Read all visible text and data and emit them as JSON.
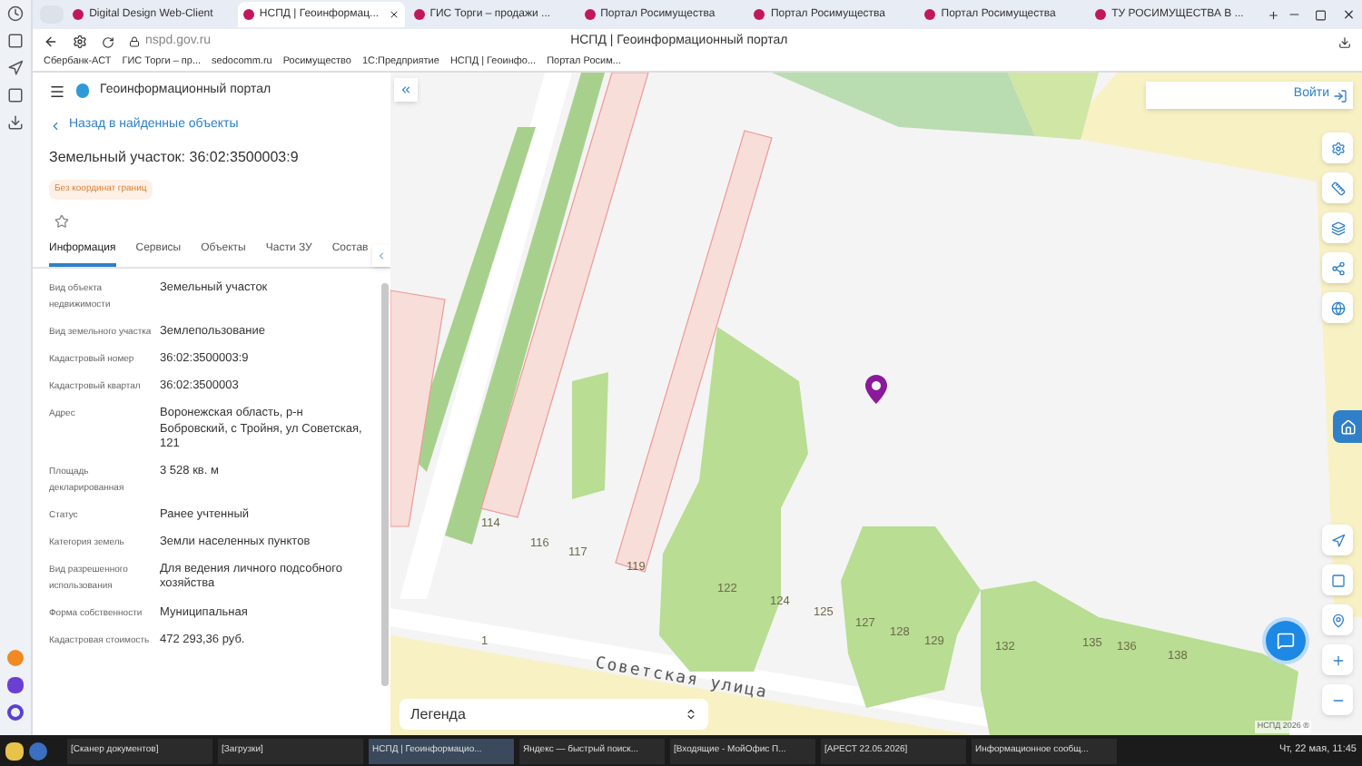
{
  "browser": {
    "tabs": [
      {
        "title": "Digital Design Web-Client",
        "selected": false
      },
      {
        "title": "НСПД | Геоинформац...",
        "selected": true
      },
      {
        "title": "ГИС Торги – продажи ...",
        "selected": false
      },
      {
        "title": "Портал Росимущества",
        "selected": false
      },
      {
        "title": "Портал Росимущества",
        "selected": false
      },
      {
        "title": "Портал Росимущества",
        "selected": false
      },
      {
        "title": "ТУ РОСИМУЩЕСТВА В ...",
        "selected": false
      }
    ],
    "address": "nspd.gov.ru",
    "page_title": "НСПД | Геоинформационный портал",
    "bookmarks": [
      "Сбербанк-АСТ",
      "ГИС Торги – пр...",
      "sedocomm.ru",
      "Росимущество",
      "1С:Предприятие",
      "НСПД | Геоинфо...",
      "Портал Росим..."
    ]
  },
  "panel": {
    "portal_name": "Геоинформационный портал",
    "back_link": "Назад в найденные объекты",
    "title": "Земельный участок: 36:02:3500003:9",
    "badge": "Без координат границ",
    "tabs": [
      {
        "label": "Информация",
        "selected": true
      },
      {
        "label": "Сервисы",
        "selected": false
      },
      {
        "label": "Объекты",
        "selected": false
      },
      {
        "label": "Части ЗУ",
        "selected": false
      },
      {
        "label": "Состав",
        "selected": false
      }
    ],
    "rows": [
      {
        "label": "Вид объекта недвижимости",
        "value": "Земельный участок"
      },
      {
        "label": "Вид земельного участка",
        "value": "Землепользование"
      },
      {
        "label": "Кадастровый номер",
        "value": "36:02:3500003:9"
      },
      {
        "label": "Кадастровый квартал",
        "value": "36:02:3500003"
      },
      {
        "label": "Адрес",
        "value": "Воронежская область, р-н Бобровский, с Тройня, ул Советская, 121"
      },
      {
        "label": "Площадь декларированная",
        "value": "3 528 кв. м"
      },
      {
        "label": "Статус",
        "value": "Ранее учтенный"
      },
      {
        "label": "Категория земель",
        "value": "Земли населенных пунктов"
      },
      {
        "label": "Вид разрешенного использования",
        "value": "Для ведения личного подсобного хозяйства"
      },
      {
        "label": "Форма собственности",
        "value": "Муниципальная"
      },
      {
        "label": "Кадастровая стоимость",
        "value": "472 293,36 руб."
      }
    ]
  },
  "map": {
    "login_button": "Войти",
    "house_numbers": [
      "114",
      "116",
      "117",
      "119",
      "122",
      "124",
      "125",
      "127",
      "128",
      "129",
      "132",
      "135",
      "136",
      "138",
      "1"
    ],
    "street": "Советская улица",
    "legend": "Легенда",
    "attribution": "НСПД 2026 ®"
  },
  "taskbar": {
    "items": [
      {
        "title": "[Сканер документов]",
        "selected": false
      },
      {
        "title": "[Загрузки]",
        "selected": false
      },
      {
        "title": "НСПД | Геоинформацио...",
        "selected": true
      },
      {
        "title": "Яндекс — быстрый поиск...",
        "selected": false
      },
      {
        "title": "[Входящие - МойОфис П...",
        "selected": false
      },
      {
        "title": "[АРЕСТ 22.05.2026]",
        "selected": false
      },
      {
        "title": "Информационное сообщ...",
        "selected": false
      }
    ],
    "clock": "Чт, 22 мая, 11:45"
  }
}
